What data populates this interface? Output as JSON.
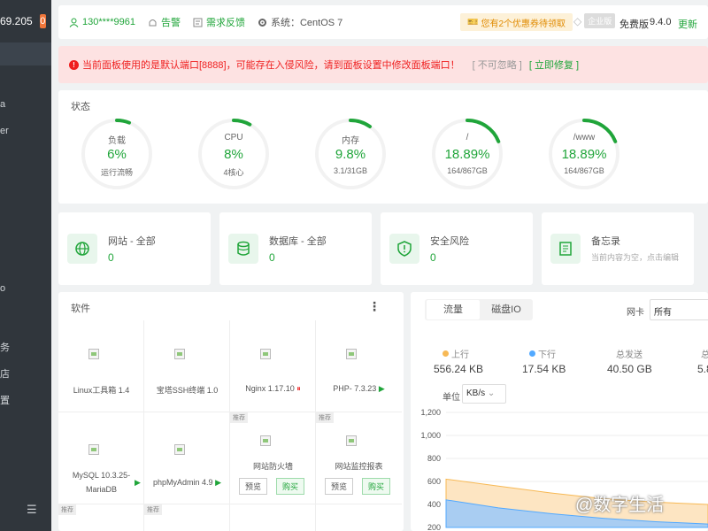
{
  "sidebar": {
    "ip": "69.205",
    "badge": "0",
    "items": [
      "a",
      "er",
      "o",
      "务",
      "店",
      "置"
    ],
    "menu_icon": "hamburger-icon"
  },
  "topbar": {
    "user": "130****9961",
    "alarm": "告警",
    "feedback": "需求反馈",
    "system": "系统：CentOS 7",
    "coupon": "您有2个优惠券待领取",
    "enterprise_tag": "企业版",
    "edition": "免费版",
    "version": "9.4.0",
    "update": "更新"
  },
  "alert": {
    "message": "当前面板使用的是默认端口[8888]，可能存在入侵风险，请到面板设置中修改面板端口！",
    "ignore": "[ 不可忽略 ]",
    "fix": "[ 立即修复 ]"
  },
  "status": {
    "title": "状态",
    "gauges": [
      {
        "label": "负载",
        "value": "6%",
        "sub": "运行流畅",
        "percent": 6
      },
      {
        "label": "CPU",
        "value": "8%",
        "sub": "4核心",
        "percent": 8
      },
      {
        "label": "内存",
        "value": "9.8%",
        "sub": "3.1/31GB",
        "percent": 9.8
      },
      {
        "label": "/",
        "value": "18.89%",
        "sub": "164/867GB",
        "percent": 18.89
      },
      {
        "label": "/www",
        "value": "18.89%",
        "sub": "164/867GB",
        "percent": 18.89
      }
    ]
  },
  "cards": [
    {
      "title": "网站 - 全部",
      "value": "0",
      "icon": "globe-icon"
    },
    {
      "title": "数据库 - 全部",
      "value": "0",
      "icon": "database-icon"
    },
    {
      "title": "安全风险",
      "value": "0",
      "icon": "shield-icon"
    },
    {
      "title": "备忘录",
      "sub": "当前内容为空，点击编辑",
      "icon": "memo-icon"
    }
  ],
  "software": {
    "title": "软件",
    "items": [
      {
        "name": "Linux工具箱 1.4"
      },
      {
        "name": "宝塔SSH终端 1.0"
      },
      {
        "name": "Nginx 1.17.10",
        "status": "⏸"
      },
      {
        "name": "PHP- 7.3.23",
        "status": "▶"
      },
      {
        "name_l1": "MySQL 10.3.25-",
        "name_l2": "MariaDB",
        "status": "▶"
      },
      {
        "name": "phpMyAdmin 4.9",
        "status": "▶"
      },
      {
        "name": "网站防火墙",
        "tag": "推荐",
        "preview": "预览",
        "buy": "购买"
      },
      {
        "name": "网站监控报表",
        "tag": "推荐",
        "preview": "预览",
        "buy": "购买"
      }
    ],
    "row3_tags": [
      "推荐",
      "推荐"
    ]
  },
  "traffic": {
    "tabs": [
      "流量",
      "磁盘IO"
    ],
    "nic_label": "网卡",
    "nic_value": "所有",
    "stats": [
      {
        "label": "上行",
        "value": "556.24 KB",
        "color": "#f7b955"
      },
      {
        "label": "下行",
        "value": "17.54 KB",
        "color": "#52a9ff"
      },
      {
        "label": "总发送",
        "value": "40.50 GB"
      },
      {
        "label": "总",
        "value": "5.8"
      }
    ],
    "unit_label": "单位",
    "unit_value": "KB/s"
  },
  "chart_data": {
    "type": "area",
    "yticks": [
      "1,200",
      "1,000",
      "800",
      "600",
      "400",
      "200"
    ],
    "ylim": [
      200,
      1200
    ],
    "series": [
      {
        "name": "上行",
        "color": "#f7b955",
        "values": [
          620,
          560,
          500,
          450,
          420,
          400
        ]
      },
      {
        "name": "下行",
        "color": "#52a9ff",
        "values": [
          440,
          370,
          320,
          280,
          250,
          230
        ]
      }
    ]
  },
  "watermark": "@数字生活"
}
